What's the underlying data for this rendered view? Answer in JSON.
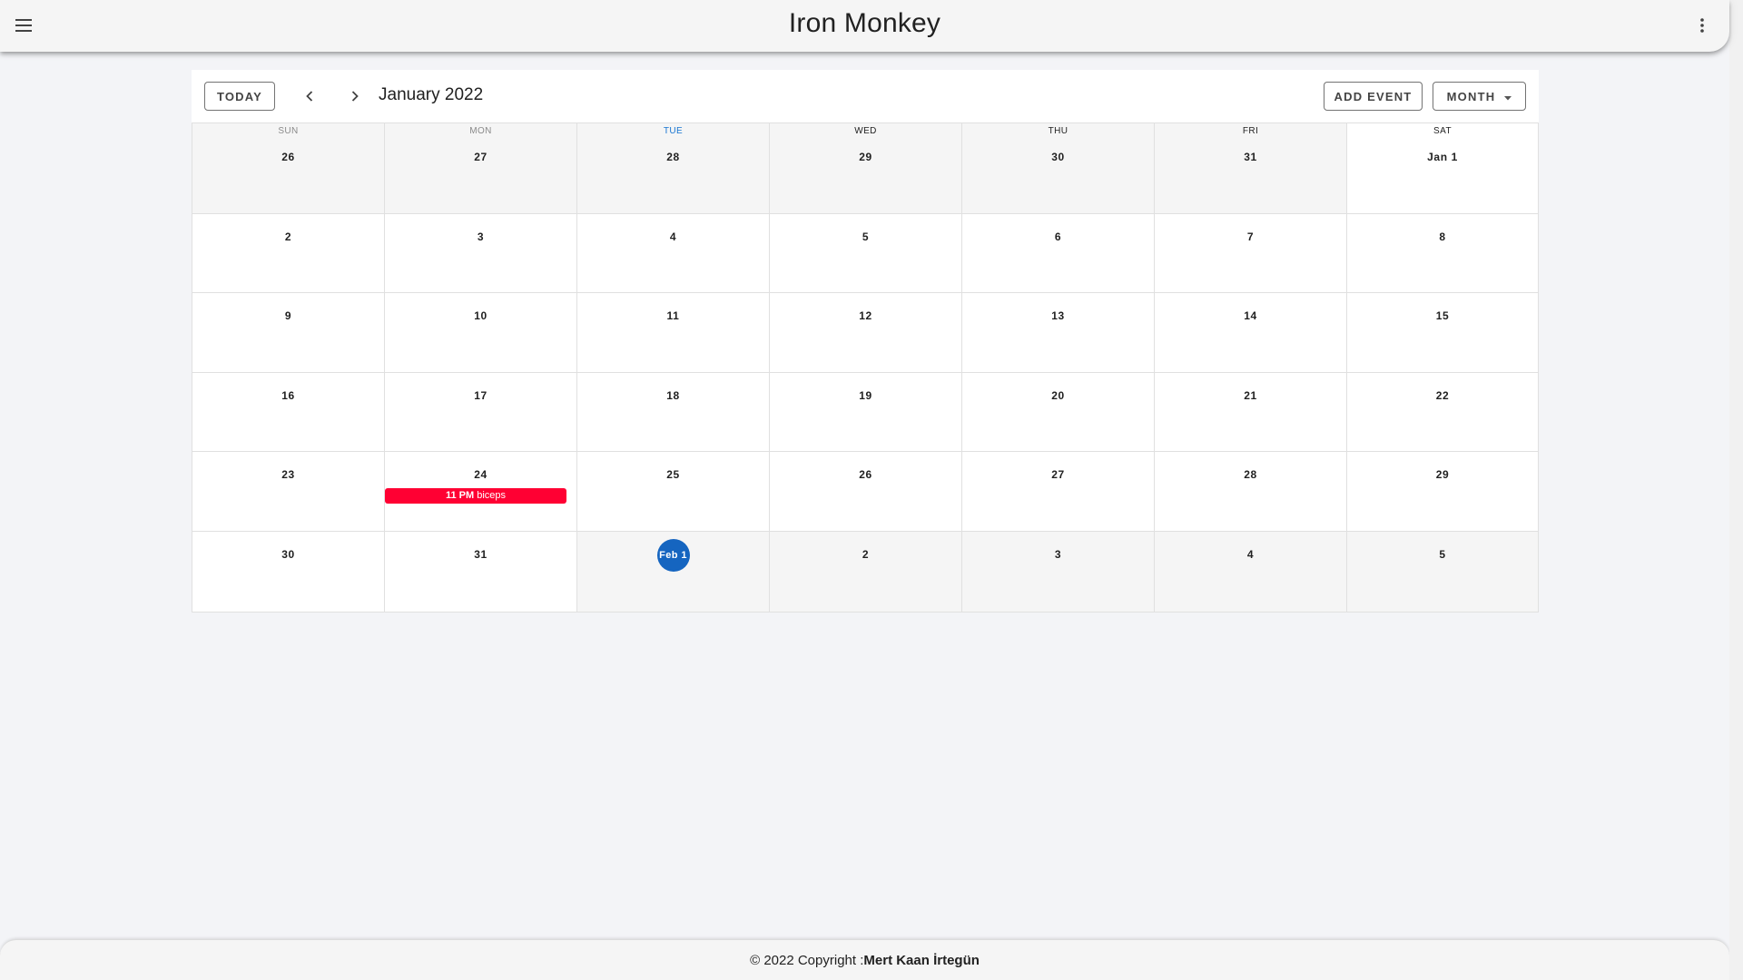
{
  "app": {
    "title": "Iron Monkey",
    "menu_icon": "hamburger-menu-icon",
    "more_icon": "more-vert-icon"
  },
  "toolbar": {
    "today_label": "TODAY",
    "prev_icon": "chevron-left-icon",
    "next_icon": "chevron-right-icon",
    "period_title": "January 2022",
    "add_event_label": "ADD EVENT",
    "view_label": "MONTH",
    "view_dropdown_icon": "caret-down-icon"
  },
  "calendar": {
    "weekdays": [
      "SUN",
      "MON",
      "TUE",
      "WED",
      "THU",
      "FRI",
      "SAT"
    ],
    "highlight_weekday_index": 2,
    "weeks": [
      [
        "26",
        "27",
        "28",
        "29",
        "30",
        "31",
        "Jan 1"
      ],
      [
        "2",
        "3",
        "4",
        "5",
        "6",
        "7",
        "8"
      ],
      [
        "9",
        "10",
        "11",
        "12",
        "13",
        "14",
        "15"
      ],
      [
        "16",
        "17",
        "18",
        "19",
        "20",
        "21",
        "22"
      ],
      [
        "23",
        "24",
        "25",
        "26",
        "27",
        "28",
        "29"
      ],
      [
        "30",
        "31",
        "Feb 1",
        "2",
        "3",
        "4",
        "5"
      ]
    ],
    "today_label": "Feb 1",
    "events": [
      {
        "week": 4,
        "day": 1,
        "time": "11 PM",
        "name": "biceps",
        "color": "#ff0033"
      }
    ],
    "today_color": "#1565c0"
  },
  "footer": {
    "copyright": "© 2022 Copyright : ",
    "author": "Mert Kaan İrtegün"
  }
}
